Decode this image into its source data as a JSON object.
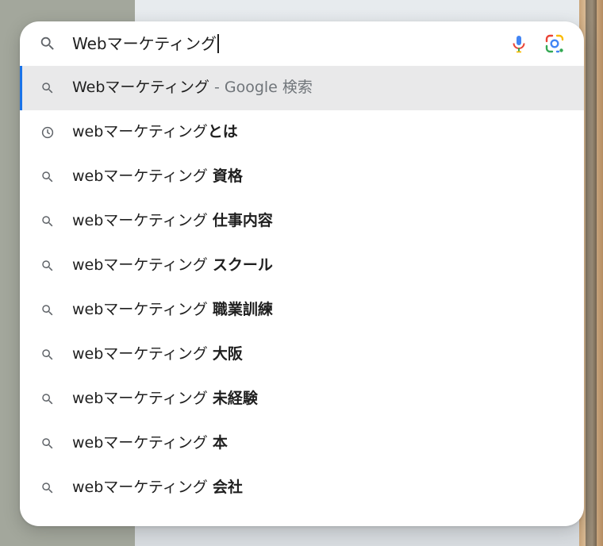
{
  "search": {
    "query": "Webマーケティング"
  },
  "icons": {
    "search": "search-icon",
    "history": "history-clock-icon",
    "voice": "microphone-icon",
    "lens": "google-lens-icon"
  },
  "colors": {
    "accent": "#1a73e8",
    "highlight": "#e9e9ea",
    "hint": "#70757a"
  },
  "suggestions": [
    {
      "type": "search",
      "text": "Webマーケティング",
      "suffix": "",
      "hint": " - Google 検索",
      "active": true
    },
    {
      "type": "history",
      "text": "webマーケティング",
      "suffix": "とは",
      "hint": ""
    },
    {
      "type": "search",
      "text": "webマーケティング ",
      "suffix": "資格",
      "hint": ""
    },
    {
      "type": "search",
      "text": "webマーケティング ",
      "suffix": "仕事内容",
      "hint": ""
    },
    {
      "type": "search",
      "text": "webマーケティング ",
      "suffix": "スクール",
      "hint": ""
    },
    {
      "type": "search",
      "text": "webマーケティング ",
      "suffix": "職業訓練",
      "hint": ""
    },
    {
      "type": "search",
      "text": "webマーケティング ",
      "suffix": "大阪",
      "hint": ""
    },
    {
      "type": "search",
      "text": "webマーケティング ",
      "suffix": "未経験",
      "hint": ""
    },
    {
      "type": "search",
      "text": "webマーケティング ",
      "suffix": "本",
      "hint": ""
    },
    {
      "type": "search",
      "text": "webマーケティング ",
      "suffix": "会社",
      "hint": ""
    }
  ]
}
